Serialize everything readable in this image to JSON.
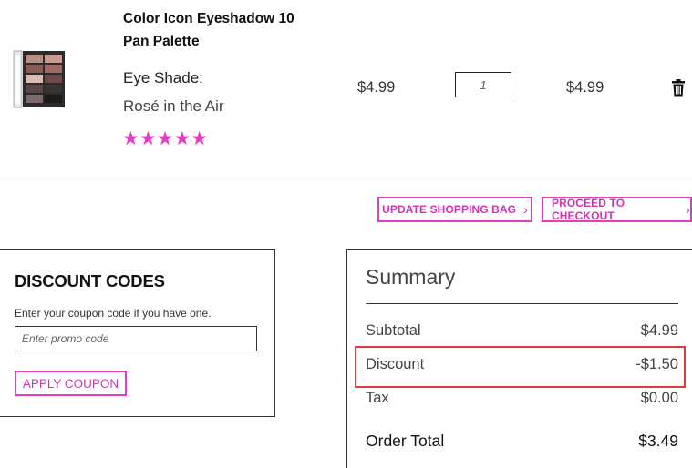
{
  "product": {
    "name": "Color Icon Eyeshadow 10 Pan Palette",
    "attribute_label": "Eye Shade:",
    "attribute_value": "Rosé in the Air",
    "rating": "★★★★★",
    "unit_price": "$4.99",
    "quantity": "1",
    "subtotal": "$4.99",
    "image_icon": "eyeshadow-palette",
    "delete_icon": "trash-icon"
  },
  "actions": {
    "update_label": "UPDATE SHOPPING BAG",
    "checkout_label": "PROCEED TO CHECKOUT",
    "chevron": "›"
  },
  "discount": {
    "title": "DISCOUNT CODES",
    "help_text": "Enter your coupon code if you have one.",
    "placeholder": "Enter promo code",
    "apply_label": "APPLY COUPON"
  },
  "summary": {
    "title": "Summary",
    "subtotal_label": "Subtotal",
    "subtotal_value": "$4.99",
    "discount_label": "Discount",
    "discount_value": "-$1.50",
    "tax_label": "Tax",
    "tax_value": "$0.00",
    "total_label": "Order Total",
    "total_value": "$3.49"
  },
  "colors": {
    "accent": "#e43cc0",
    "highlight": "#e03a3e"
  }
}
